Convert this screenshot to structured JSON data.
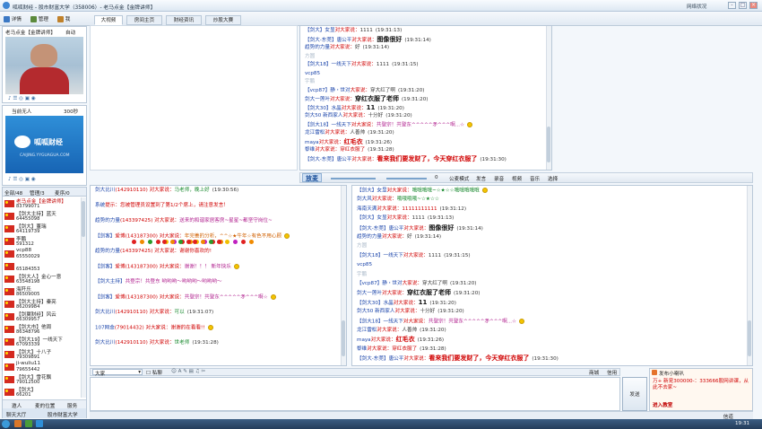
{
  "window": {
    "title": "呱呱财经 - 股市财富大学（358006）- 老马点金【金牌讲师】",
    "net_status": "网络状况"
  },
  "toolbar": {
    "items": [
      "详情",
      "管理",
      "我"
    ]
  },
  "host": {
    "name": "老马点金【金牌讲师】",
    "mode": "自动",
    "title": "当前无人",
    "seconds": "300秒",
    "logo": "呱呱财经",
    "logo_url": "CAIJING.YYGUAGUA.COM"
  },
  "tabs": [
    "大视频",
    "房间主页",
    "财经资讯",
    "炒股大赛"
  ],
  "user_list": {
    "tabs": [
      "全部/48",
      "管理/3",
      "麦序/0"
    ],
    "users": [
      {
        "name": "老马点金【金牌讲师】",
        "id": "83799071"
      },
      {
        "name": "【剑大主持】蓝天",
        "id": "64455098"
      },
      {
        "name": "【剑大】董瑞",
        "id": "64119739"
      },
      {
        "name": "李鹏",
        "id": "591312"
      },
      {
        "name": "vcp88",
        "id": "65550029"
      },
      {
        "name": "",
        "id": "65184353"
      },
      {
        "name": "【剑大人】金心一意",
        "id": "63548198"
      },
      {
        "name": "海阡乐",
        "id": "86509005"
      },
      {
        "name": "【剑大主持】秦亮",
        "id": "86209984"
      },
      {
        "name": "【剑翼财经】风云",
        "id": "66309957"
      },
      {
        "name": "【剑大市】他周",
        "id": "86348796"
      },
      {
        "name": "【剑大19】一线天下",
        "id": "67093339"
      },
      {
        "name": "【剑大】十八子",
        "id": "79309891"
      },
      {
        "name": "ji-wuliu11",
        "id": "79655442"
      },
      {
        "name": "【剑大】雪花飘",
        "id": "79012500"
      },
      {
        "name": "【剑大】",
        "id": "66201"
      }
    ],
    "bottom_tabs": [
      "邀人",
      "麦的位置",
      "服务"
    ],
    "footer_tabs": [
      "聊天大厅",
      "股市财富大学"
    ]
  },
  "top_chat": [
    {
      "name": "【剑大】女显",
      "mid": "对大家说：",
      "msg": "1111",
      "time": "(19:31:13)"
    },
    {
      "name": "【剑大-东莞】唐公平",
      "mid": "对大家说：",
      "msg": "图像很好",
      "time": "(19:31:14)"
    },
    {
      "name": "趋势的力量",
      "mid": "对大家说：",
      "msg": "好",
      "time": "(19:31:14)"
    },
    {
      "name": "",
      "mid": "",
      "msg": "方圆",
      "time": ""
    },
    {
      "name": "【剑大18】一线天下",
      "mid": "对大家说：",
      "msg": "1111",
      "time": "(19:31:15)"
    },
    {
      "name": "vcp85",
      "mid": "",
      "msg": "",
      "time": ""
    },
    {
      "name": "",
      "mid": "",
      "msg": "宇鹏",
      "time": ""
    },
    {
      "name": "【vcp87】静・世对",
      "mid": "大家说：",
      "msg": "穿大红了啊",
      "time": "(19:31:20)"
    },
    {
      "name": "剑大一莲叶",
      "mid": "对大家说：",
      "msg": "穿红衣服了老师",
      "time": "(19:31:20)"
    },
    {
      "name": "【剑大30】水晶",
      "mid": "对大家说：",
      "msg": "11",
      "time": "(19:31:20)"
    },
    {
      "name": "剑大50 新西家人",
      "mid": "对大家说：",
      "msg": "十分好",
      "time": "(19:31:20)"
    },
    {
      "name": "【剑大18】一线天下",
      "mid": "对大家说：",
      "msg": "共登宗！共登东^^^^^矛^^^啊...☆",
      "time": ""
    },
    {
      "name": "龙江雷松",
      "mid": "对大家说：",
      "msg": "人善帅",
      "time": "(19:31:20)"
    },
    {
      "name": "maya",
      "mid": "对大家说：",
      "msg": "红毛衣",
      "time": "(19:31:26)"
    },
    {
      "name": "黎维",
      "mid": "对大家说：",
      "msg": "穿红衣服了",
      "time": "(19:31:28)"
    },
    {
      "name": "【剑大-东莞】唐公平",
      "mid": "对大家说：",
      "msg": "看来我们要发财了，今天穿红衣服了",
      "time": "(19:31:30)"
    }
  ],
  "controls": {
    "play_label": "放麦",
    "buttons": [
      "公麦模式",
      "发言",
      "录音",
      "视频",
      "音乐",
      "选择"
    ],
    "counter": "0"
  },
  "left_chat": [
    {
      "name": "剑大比川",
      "mid": "(142910110) 对大家说：",
      "msg": "马老师，晚上好",
      "time": "(19:30:56)"
    },
    {
      "name": "系统",
      "mid": "提示：",
      "msg": "您被管理员设置到了第1/2个席上，请注意发言！",
      "time": ""
    },
    {
      "name": "趋势的力量",
      "mid": "(143397425) 对大家说：",
      "msg": "送来的和谐家居客房~星星~都坚守岗位~",
      "time": ""
    },
    {
      "name": "【剑客】",
      "mid": "爱博(143187300) 对大家说：",
      "msg": "年完善的分析，^^☆★牛年☆有色不用心顾",
      "time": ""
    },
    {
      "name": "趋势的力量",
      "mid": "(143397425) 对大家说：",
      "msg": "谢谢你喜欢的!",
      "time": ""
    },
    {
      "name": "【剑客】",
      "mid": "爱博(143187300) 对大家说：",
      "msg": "谢谢！！！ 新年快乐",
      "time": ""
    },
    {
      "name": "【剑大主持】",
      "mid": "",
      "msg": "共登宗！共登东 哟哟哟～哟哟哟～哟哟哟～",
      "time": ""
    },
    {
      "name": "【剑客】",
      "mid": "爱博(143187300) 对大家说：",
      "msg": "共登宗！共登东^^^^^矛^^^啊☆",
      "time": ""
    },
    {
      "name": "剑大比川",
      "mid": "(142910110) 对大家说：",
      "msg": "可以",
      "time": "(19:31:07)"
    },
    {
      "name": "107网金",
      "mid": "(79014432) 对大家说：",
      "msg": "谢谢的在看看!!",
      "time": ""
    },
    {
      "name": "剑大比川",
      "mid": "(142910110) 对大家说：",
      "msg": "世老师",
      "time": "(19:31:28)"
    }
  ],
  "right_chat": [
    {
      "name": "【剑大】女显",
      "mid": "对大家说：",
      "msg": "哦哦哦哦~☆★☆☆哦哦哦哦哦",
      "time": ""
    },
    {
      "name": "剑大风",
      "mid": "对大家说：",
      "msg": "哦哦哦哦~☆★☆☆",
      "time": ""
    },
    {
      "name": "海南天满",
      "mid": "对大家说：",
      "msg": "11111111111",
      "time": "(19:31:12)"
    },
    {
      "name": "【剑大】女显",
      "mid": "对大家说：",
      "msg": "1111",
      "time": "(19:31:13)"
    },
    {
      "name": "【剑大-东莞】唐公平",
      "mid": "对大家说：",
      "msg": "图像很好",
      "time": "(19:31:14)"
    },
    {
      "name": "趋势的力量",
      "mid": "对大家说：",
      "msg": "好",
      "time": "(19:31:14)"
    },
    {
      "name": "",
      "mid": "",
      "msg": "方圆",
      "time": ""
    },
    {
      "name": "【剑大18】一线天下",
      "mid": "对大家说：",
      "msg": "1111",
      "time": "(19:31:15)"
    },
    {
      "name": "vcp85",
      "mid": "",
      "msg": "",
      "time": ""
    },
    {
      "name": "",
      "mid": "",
      "msg": "宇鹏",
      "time": ""
    },
    {
      "name": "【vcp87】静・世对",
      "mid": "大家说：",
      "msg": "穿大红了啊",
      "time": "(19:31:20)"
    },
    {
      "name": "剑大一莲叶",
      "mid": "对大家说：",
      "msg": "穿红衣服了老师",
      "time": "(19:31:20)"
    },
    {
      "name": "【剑大30】水晶",
      "mid": "对大家说：",
      "msg": "11",
      "time": "(19:31:20)"
    },
    {
      "name": "剑大50 新西家人",
      "mid": "对大家说：",
      "msg": "十分好",
      "time": "(19:31:20)"
    },
    {
      "name": "【剑大18】一线天下",
      "mid": "对大家说：",
      "msg": "共登宗！共登东^^^^^矛^^^啊...☆",
      "time": ""
    },
    {
      "name": "龙江雷松",
      "mid": "对大家说：",
      "msg": "人善帅",
      "time": "(19:31:20)"
    },
    {
      "name": "maya",
      "mid": "对大家说：",
      "msg": "红毛衣",
      "time": "(19:31:26)"
    },
    {
      "name": "黎维",
      "mid": "对大家说：",
      "msg": "穿红衣服了",
      "time": "(19:31:28)"
    },
    {
      "name": "【剑大-东莞】唐公平",
      "mid": "对大家说：",
      "msg": "看来我们要发财了，今天穿红衣服了",
      "time": "(19:31:30)"
    }
  ],
  "input": {
    "target": "大家",
    "private_label": "私聊",
    "send_label": "发送",
    "status": "聊天模式：双击",
    "tools": [
      "商城",
      "信用"
    ]
  },
  "notice": {
    "title": "发布小喇叭",
    "lines": [
      "万+ 新宠300000-：333666股网讲课，从此不去家~",
      "进入教室"
    ]
  },
  "taskbar": {
    "clock": "19:31",
    "status": "信道"
  }
}
